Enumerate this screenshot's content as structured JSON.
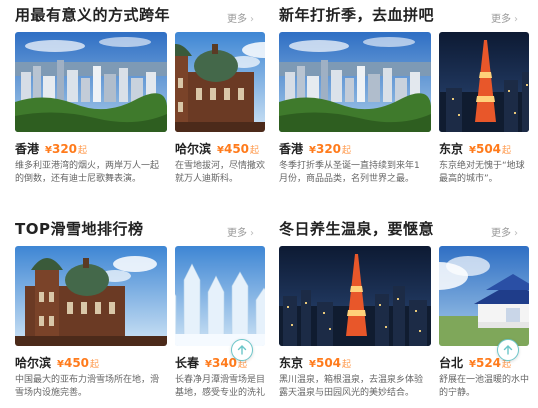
{
  "more_label": "更多",
  "sections": [
    {
      "title": "用最有意义的方式跨年",
      "cards": [
        {
          "city": "香港",
          "price": "320",
          "unit": "起",
          "desc": [
            "维多利亚港湾的烟火，两岸万人一起",
            "的倒数，还有迪士尼歌舞表演。"
          ]
        },
        {
          "city": "哈尔滨",
          "price": "450",
          "unit": "起",
          "desc": [
            "在雪地拔河，尽情撒欢",
            "就万人迪斯科。"
          ]
        }
      ]
    },
    {
      "title": "新年打折季，去血拼吧",
      "cards": [
        {
          "city": "香港",
          "price": "320",
          "unit": "起",
          "desc": [
            "冬季打折季从圣诞一直持续到来年1",
            "月份，商品品类，名列世界之最。"
          ]
        },
        {
          "city": "东京",
          "price": "504",
          "unit": "起",
          "desc": [
            "东京绝对无愧于“地球",
            "最高的城市”。"
          ]
        }
      ]
    },
    {
      "title": "TOP滑雪地排行榜",
      "cards": [
        {
          "city": "哈尔滨",
          "price": "450",
          "unit": "起",
          "desc": [
            "中国最大的亚布力滑雪场所在地，滑",
            "雪场内设施完善。"
          ]
        },
        {
          "city": "长春",
          "price": "340",
          "unit": "起",
          "desc": [
            "长春净月潭滑雪场是目",
            "基地，感受专业的洗礼"
          ]
        }
      ]
    },
    {
      "title": "冬日养生温泉，要惬意",
      "cards": [
        {
          "city": "东京",
          "price": "504",
          "unit": "起",
          "desc": [
            "黑川温泉，箱根温泉，去温泉乡体验",
            "露天温泉与田园风光的美妙结合。"
          ]
        },
        {
          "city": "台北",
          "price": "524",
          "unit": "起",
          "desc": [
            "舒展在一池温暖的水中",
            "的宁静。"
          ]
        }
      ]
    }
  ],
  "currency_symbol": "¥",
  "icons": {
    "more": "chevron-right-icon",
    "back_to_top": "arrow-up-icon"
  },
  "colors": {
    "price": "#ff7b1c",
    "accent": "#6cc6c9",
    "muted": "#999999"
  }
}
